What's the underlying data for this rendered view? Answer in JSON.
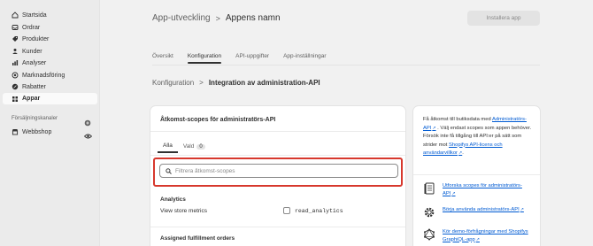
{
  "sidebar": {
    "items": [
      {
        "label": "Startsida",
        "icon": "home-icon"
      },
      {
        "label": "Ordrar",
        "icon": "inbox-icon"
      },
      {
        "label": "Produkter",
        "icon": "tag-icon"
      },
      {
        "label": "Kunder",
        "icon": "person-icon"
      },
      {
        "label": "Analyser",
        "icon": "chart-icon"
      },
      {
        "label": "Marknadsföring",
        "icon": "target-icon"
      },
      {
        "label": "Rabatter",
        "icon": "discount-icon"
      },
      {
        "label": "Appar",
        "icon": "apps-icon"
      }
    ],
    "channels_label": "Försäljningskanaler",
    "channels": [
      {
        "label": "Webbshop",
        "icon": "store-icon"
      }
    ]
  },
  "header": {
    "parent": "App-utveckling",
    "separator": ">",
    "current": "Appens namn",
    "install_label": "Installera app"
  },
  "tabs": [
    {
      "label": "Översikt"
    },
    {
      "label": "Konfiguration"
    },
    {
      "label": "API-uppgifter"
    },
    {
      "label": "App-inställningar"
    }
  ],
  "subcrumb": {
    "parent": "Konfiguration",
    "separator": ">",
    "current": "Integration av administration-API"
  },
  "scopes_card": {
    "title": "Åtkomst-scopes för administratörs-API",
    "filter_tabs": [
      {
        "label": "Alla"
      },
      {
        "label": "Vald",
        "count": "0"
      }
    ],
    "search_placeholder": "Filtrera åtkomst-scopes",
    "groups": [
      {
        "title": "Analytics",
        "description": "View store metrics",
        "scope": "read_analytics"
      },
      {
        "title": "Assigned fulfillment orders"
      }
    ]
  },
  "info_card": {
    "text_1": "Få åtkomst till butiksdata med",
    "link_1": "Administratörs-API",
    "text_2": ". Välj endast scopes som appen behöver. Försök inte få tillgång till API:er på sätt som strider mot",
    "link_2": "Shopifys API-licens och användarvillkor",
    "text_3": ".",
    "resources": [
      {
        "label": "Utforska scopes för administratörs-API",
        "icon": "document-icon"
      },
      {
        "label": "Börja använda administratörs-API",
        "icon": "gear-icon"
      },
      {
        "label": "Kör demo-förfrågningar med Shopifys GraphiQL-app",
        "icon": "graphql-icon"
      }
    ]
  }
}
